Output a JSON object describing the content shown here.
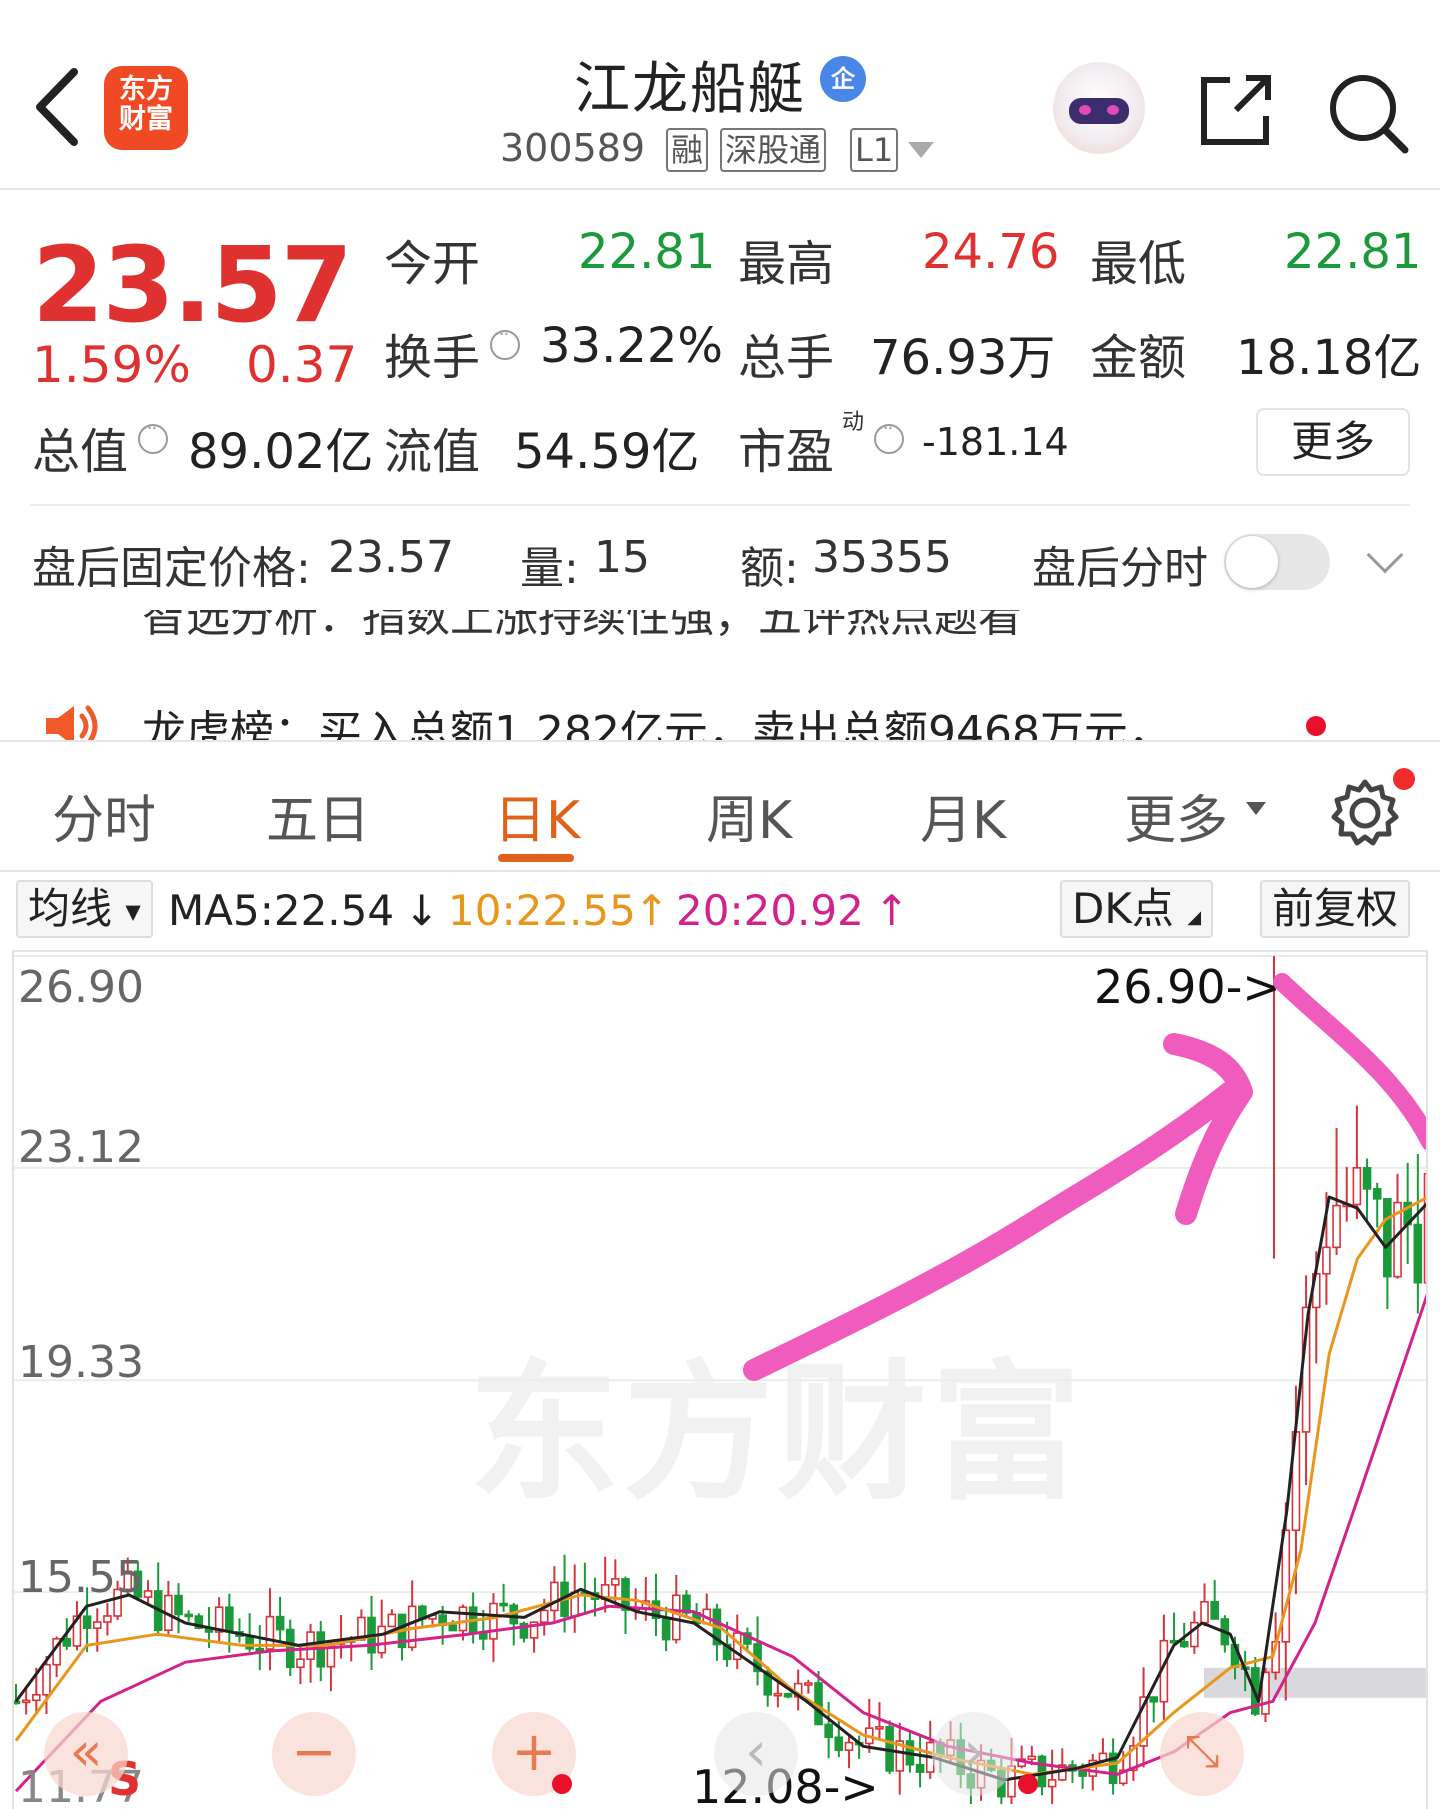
{
  "header": {
    "logo_text_line1": "东方",
    "logo_text_line2": "财富",
    "stock_name": "江龙船艇",
    "enterprise_badge": "企",
    "stock_code": "300589",
    "tags": [
      "融",
      "深股通",
      "L1"
    ],
    "icons": [
      "back-arrow-icon",
      "robot-assistant-icon",
      "share-icon",
      "search-icon"
    ]
  },
  "quote": {
    "price": "23.57",
    "change_pct": "1.59%",
    "change_amt": "0.37",
    "open_label": "今开",
    "open": "22.81",
    "high_label": "最高",
    "high": "24.76",
    "low_label": "最低",
    "low": "22.81",
    "turnover_label": "换手",
    "turnover": "33.22%",
    "volume_label": "总手",
    "volume": "76.93万",
    "amount_label": "金额",
    "amount": "18.18亿",
    "mktcap_label": "总值",
    "mktcap": "89.02亿",
    "float_label": "流值",
    "float": "54.59亿",
    "pe_label": "市盈",
    "pe_sup": "动",
    "pe": "-181.14",
    "more_label": "更多",
    "colors": {
      "up": "#e03131",
      "down": "#1a9a3a"
    }
  },
  "after_hours": {
    "price_label": "盘后固定价格:",
    "price": "23.57",
    "vol_label": "量:",
    "vol": "15",
    "amt_label": "额:",
    "amt": "35355",
    "timeshare_label": "盘后分时",
    "toggle_on": false
  },
  "news": {
    "ghost_text": "智选分析：指数上涨持续性强，五评热点题看",
    "text": "龙虎榜：买入总额1.282亿元，卖出总额9468万元，..."
  },
  "tabs": {
    "items": [
      "分时",
      "五日",
      "日K",
      "周K",
      "月K",
      "更多"
    ],
    "active": "日K"
  },
  "ma_bar": {
    "selector": "均线",
    "ma5": "MA5:22.54",
    "ma5_arrow": "↓",
    "ma10": "10:22.55",
    "ma10_arrow": "↑",
    "ma20": "20:20.92",
    "ma20_arrow": "↑",
    "dk_label": "DK点",
    "adjust_label": "前复权",
    "colors": {
      "ma5": "#222222",
      "ma10": "#e8971c",
      "ma20": "#d4228c"
    }
  },
  "chart_data": {
    "type": "candlestick",
    "y_labels": [
      "26.90",
      "23.12",
      "19.33",
      "15.55"
    ],
    "ylim": [
      11.77,
      26.9
    ],
    "high_annotation": "26.90->",
    "low_annotation": "12.08->",
    "bottom_left_label": "11.77",
    "signal_label": "S",
    "watermark": "东方财富",
    "annotation_arrow_color": "#f05cbd",
    "ma5_path": [
      [
        0,
        13.6
      ],
      [
        5,
        15.3
      ],
      [
        8,
        15.5
      ],
      [
        12,
        15.0
      ],
      [
        16,
        14.8
      ],
      [
        20,
        14.6
      ],
      [
        26,
        14.8
      ],
      [
        30,
        15.2
      ],
      [
        36,
        15.1
      ],
      [
        40,
        15.6
      ],
      [
        44,
        15.2
      ],
      [
        48,
        15.0
      ],
      [
        52,
        14.3
      ],
      [
        56,
        13.6
      ],
      [
        60,
        12.8
      ],
      [
        65,
        12.6
      ],
      [
        70,
        12.2
      ],
      [
        75,
        12.4
      ],
      [
        78,
        12.6
      ],
      [
        82,
        14.6
      ],
      [
        84,
        15.0
      ],
      [
        86,
        14.8
      ],
      [
        88,
        13.6
      ],
      [
        90,
        17.0
      ],
      [
        91.5,
        20.5
      ],
      [
        93,
        22.6
      ],
      [
        95,
        22.4
      ],
      [
        97,
        21.7
      ],
      [
        100,
        22.5
      ]
    ],
    "ma10_path": [
      [
        0,
        12.9
      ],
      [
        5,
        14.6
      ],
      [
        10,
        14.8
      ],
      [
        16,
        14.6
      ],
      [
        22,
        14.6
      ],
      [
        28,
        14.9
      ],
      [
        34,
        15.1
      ],
      [
        40,
        15.5
      ],
      [
        44,
        15.4
      ],
      [
        50,
        14.9
      ],
      [
        55,
        13.8
      ],
      [
        60,
        13.0
      ],
      [
        66,
        12.6
      ],
      [
        72,
        12.3
      ],
      [
        78,
        12.5
      ],
      [
        82,
        13.4
      ],
      [
        86,
        14.2
      ],
      [
        89,
        14.4
      ],
      [
        91,
        16.3
      ],
      [
        93,
        19.8
      ],
      [
        95,
        21.5
      ],
      [
        97,
        22.2
      ],
      [
        100,
        22.6
      ]
    ],
    "ma20_path": [
      [
        0,
        12.0
      ],
      [
        6,
        13.6
      ],
      [
        12,
        14.3
      ],
      [
        18,
        14.5
      ],
      [
        25,
        14.6
      ],
      [
        32,
        14.8
      ],
      [
        38,
        15.0
      ],
      [
        42,
        15.3
      ],
      [
        48,
        15.2
      ],
      [
        55,
        14.4
      ],
      [
        60,
        13.4
      ],
      [
        66,
        12.8
      ],
      [
        72,
        12.5
      ],
      [
        78,
        12.3
      ],
      [
        82,
        12.7
      ],
      [
        86,
        13.4
      ],
      [
        89,
        13.6
      ],
      [
        92,
        15.0
      ],
      [
        95,
        17.2
      ],
      [
        100,
        20.9
      ]
    ]
  },
  "floating_buttons": [
    "collapse-left-icon",
    "zoom-out-icon",
    "zoom-in-icon",
    "chart-nav-icon",
    "fullscreen-icon"
  ]
}
